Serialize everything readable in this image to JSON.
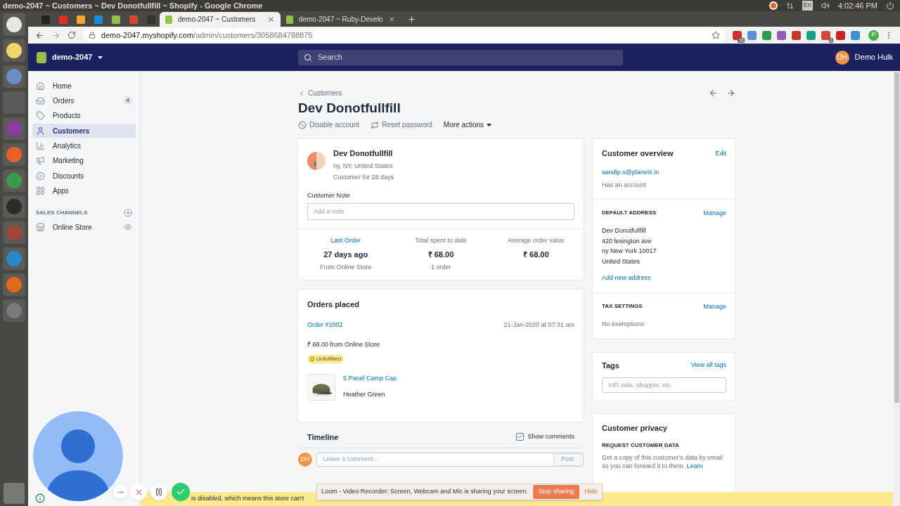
{
  "os_bar": {
    "title": "demo-2047 ~ Customers ~ Dev Donotfullfill ~ Shopify - Google Chrome",
    "language": "En",
    "time": "4:02:46 PM"
  },
  "browser": {
    "tabs": [
      {
        "title": "demo-2047 ~ Customers",
        "selected": true
      },
      {
        "title": "demo-2047 ~ Ruby-Develo",
        "selected": false
      }
    ],
    "url_host": "demo-2047.myshopify.com",
    "url_path": "/admin/customers/3058684788875",
    "extension_badges": [
      "26",
      "6"
    ],
    "profile": "P"
  },
  "topbar": {
    "store": "demo-2047",
    "search_placeholder": "Search",
    "user_initials": "DH",
    "user_name": "Demo Hulk"
  },
  "sidebar": {
    "items": [
      {
        "kind": "home",
        "label": "Home",
        "selected": false
      },
      {
        "kind": "orders",
        "label": "Orders",
        "badge": "4",
        "selected": false
      },
      {
        "kind": "products",
        "label": "Products",
        "selected": false
      },
      {
        "kind": "customers",
        "label": "Customers",
        "selected": true
      },
      {
        "kind": "analytics",
        "label": "Analytics",
        "selected": false
      },
      {
        "kind": "marketing",
        "label": "Marketing",
        "selected": false
      },
      {
        "kind": "discounts",
        "label": "Discounts",
        "selected": false
      },
      {
        "kind": "apps",
        "label": "Apps",
        "selected": false
      }
    ],
    "section": "SALES CHANNELS",
    "channels": [
      {
        "label": "Online Store"
      }
    ]
  },
  "page": {
    "breadcrumb": "Customers",
    "title": "Dev Donotfullfill",
    "actions": [
      {
        "kind": "disable",
        "label": "Disable account"
      },
      {
        "kind": "reset",
        "label": "Reset password"
      },
      {
        "kind": "more",
        "label": "More actions"
      }
    ]
  },
  "profile": {
    "name": "Dev Donotfullfill",
    "location": "ny, NY, United States",
    "since": "Customer for 28 days",
    "note_label": "Customer Note",
    "note_placeholder": "Add a note",
    "stats": [
      {
        "label": "Last Order",
        "link": true,
        "value": "27 days ago",
        "sub": "From Online Store"
      },
      {
        "label": "Total spent to date",
        "link": false,
        "value": "₹ 68.00",
        "sub": "1 order"
      },
      {
        "label": "Average order value",
        "link": false,
        "value": "₹ 68.00"
      }
    ]
  },
  "orders": {
    "title": "Orders placed",
    "order": "Order #1002",
    "date": "21-Jan-2020 at 07:31 am",
    "total": "₹ 68.00 from Online Store",
    "status": "Unfulfilled",
    "item": "5 Panel Camp Cap",
    "variant": "Heather Green"
  },
  "timeline": {
    "title": "Timeline",
    "show_comments": {
      "label": "Show comments",
      "checked": true
    },
    "avatar": "DH",
    "placeholder": "Leave a comment...",
    "post": "Post"
  },
  "overview": {
    "title": "Customer overview",
    "edit": "Edit",
    "email": "sandip.s@planetx.in",
    "account": "Has an account",
    "address_title": "DEFAULT ADDRESS",
    "address_manage": "Manage",
    "address": [
      "Dev Donotfullfill",
      "420 lexington ave",
      "ny New York 10017",
      "United States"
    ],
    "add_address": "Add new address",
    "tax_title": "TAX SETTINGS",
    "tax_manage": "Manage",
    "tax": "No exemptions"
  },
  "tags": {
    "title": "Tags",
    "link": "View all tags",
    "placeholder": "VIP, sale, shopper, etc."
  },
  "privacy": {
    "title": "Customer privacy",
    "subtitle": "REQUEST CUSTOMER DATA",
    "text": "Get a copy of this customer's data by email so you can forward it to them.",
    "link": "Learn"
  },
  "banner": {
    "text": "is disabled, which means this store can't"
  },
  "loom": {
    "text": "Loom - Video Recorder: Screen, Webcam and Mic is sharing your screen.",
    "stop": "Stop sharing",
    "hide": "Hide"
  }
}
